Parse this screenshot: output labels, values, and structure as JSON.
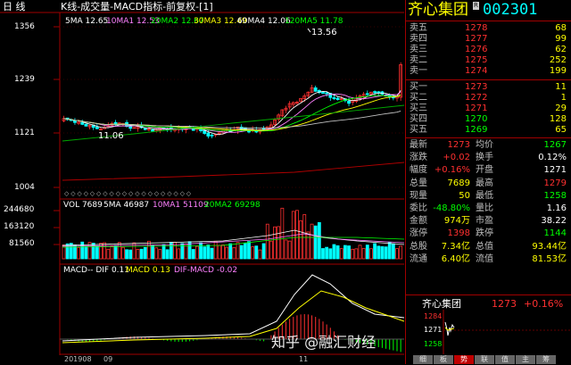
{
  "period": "日 线",
  "title": "K线-成交量-MACD指标-前复权-[1]",
  "ma": [
    {
      "t": "5MA 12.65",
      "c": "#ffffff"
    },
    {
      "t": "10MA1 12.53",
      "c": "#ff80ff"
    },
    {
      "t": "20MA2 12.67",
      "c": "#00ff00"
    },
    {
      "t": "30MA3 12.49",
      "c": "#ffff00"
    },
    {
      "t": "60MA4 12.06",
      "c": "#ffffff"
    },
    {
      "t": "120MA5 11.78",
      "c": "#00ff00"
    }
  ],
  "y_labels": [
    "1356",
    "1239",
    "1121",
    "1004"
  ],
  "hi_mark": "13.56",
  "lo_mark": "11.06",
  "vol_header": [
    {
      "t": "VOL 7689",
      "c": "#ffffff"
    },
    {
      "t": "5MA 46987",
      "c": "#ffffff"
    },
    {
      "t": "10MA1 51109",
      "c": "#ff80ff"
    },
    {
      "t": "20MA2 69298",
      "c": "#00ff00"
    }
  ],
  "vol_labels": [
    "244680",
    "163120",
    "81560"
  ],
  "macd_header": [
    {
      "t": "MACD-- DIF 0.11",
      "c": "#ffffff"
    },
    {
      "t": "MACD 0.13",
      "c": "#ffff00"
    },
    {
      "t": "DIF-MACD -0.02",
      "c": "#ff80ff"
    }
  ],
  "date_labels": [
    "201908",
    "09",
    "11"
  ],
  "stock_name": "齐心集团",
  "stock_badge": "R",
  "stock_code": "002301",
  "asks": [
    {
      "l": "卖五",
      "p": "1278",
      "v": "68"
    },
    {
      "l": "卖四",
      "p": "1277",
      "v": "99"
    },
    {
      "l": "卖三",
      "p": "1276",
      "v": "62"
    },
    {
      "l": "卖二",
      "p": "1275",
      "v": "252"
    },
    {
      "l": "卖一",
      "p": "1274",
      "v": "199"
    }
  ],
  "bids": [
    {
      "l": "买一",
      "p": "1273",
      "v": "11"
    },
    {
      "l": "买二",
      "p": "1272",
      "v": "1"
    },
    {
      "l": "买三",
      "p": "1271",
      "v": "29"
    },
    {
      "l": "买四",
      "p": "1270",
      "v": "128"
    },
    {
      "l": "买五",
      "p": "1269",
      "v": "65"
    }
  ],
  "quote": [
    {
      "l1": "最新",
      "v1": "1273",
      "c1": "#ff3030",
      "l2": "均价",
      "v2": "1267",
      "c2": "#00ff00"
    },
    {
      "l1": "涨跌",
      "v1": "+0.02",
      "c1": "#ff3030",
      "l2": "换手",
      "v2": "0.12%",
      "c2": "#ffffff"
    },
    {
      "l1": "幅度",
      "v1": "+0.16%",
      "c1": "#ff3030",
      "l2": "开盘",
      "v2": "1271",
      "c2": "#ffffff"
    },
    {
      "l1": "总量",
      "v1": "7689",
      "c1": "#ffff00",
      "l2": "最高",
      "v2": "1279",
      "c2": "#ff3030"
    },
    {
      "l1": "现量",
      "v1": "50",
      "c1": "#ffff00",
      "l2": "最低",
      "v2": "1258",
      "c2": "#00ff00"
    },
    {
      "l1": "委比",
      "v1": "-48.80%",
      "c1": "#00ff00",
      "l2": "量比",
      "v2": "1.16",
      "c2": "#ffffff"
    },
    {
      "l1": "金额",
      "v1": "974万",
      "c1": "#ffff00",
      "l2": "市盈",
      "v2": "38.22",
      "c2": "#ffffff"
    },
    {
      "l1": "涨停",
      "v1": "1398",
      "c1": "#ff3030",
      "l2": "跌停",
      "v2": "1144",
      "c2": "#00ff00"
    },
    {
      "l1": "总股",
      "v1": "7.34亿",
      "c1": "#ffff00",
      "l2": "总值",
      "v2": "93.44亿",
      "c2": "#ffff00"
    },
    {
      "l1": "流通",
      "v1": "6.40亿",
      "c1": "#ffff00",
      "l2": "流值",
      "v2": "81.53亿",
      "c2": "#ffff00"
    }
  ],
  "mini_name": "齐心集团",
  "mini_price": "1273",
  "mini_pct": "+0.16%",
  "mini_ticks": [
    "1284",
    "1271",
    "1258"
  ],
  "tabs": [
    "细",
    "板",
    "势",
    "联",
    "值",
    "主",
    "筹"
  ],
  "watermark": "知乎 @融汇财经"
}
